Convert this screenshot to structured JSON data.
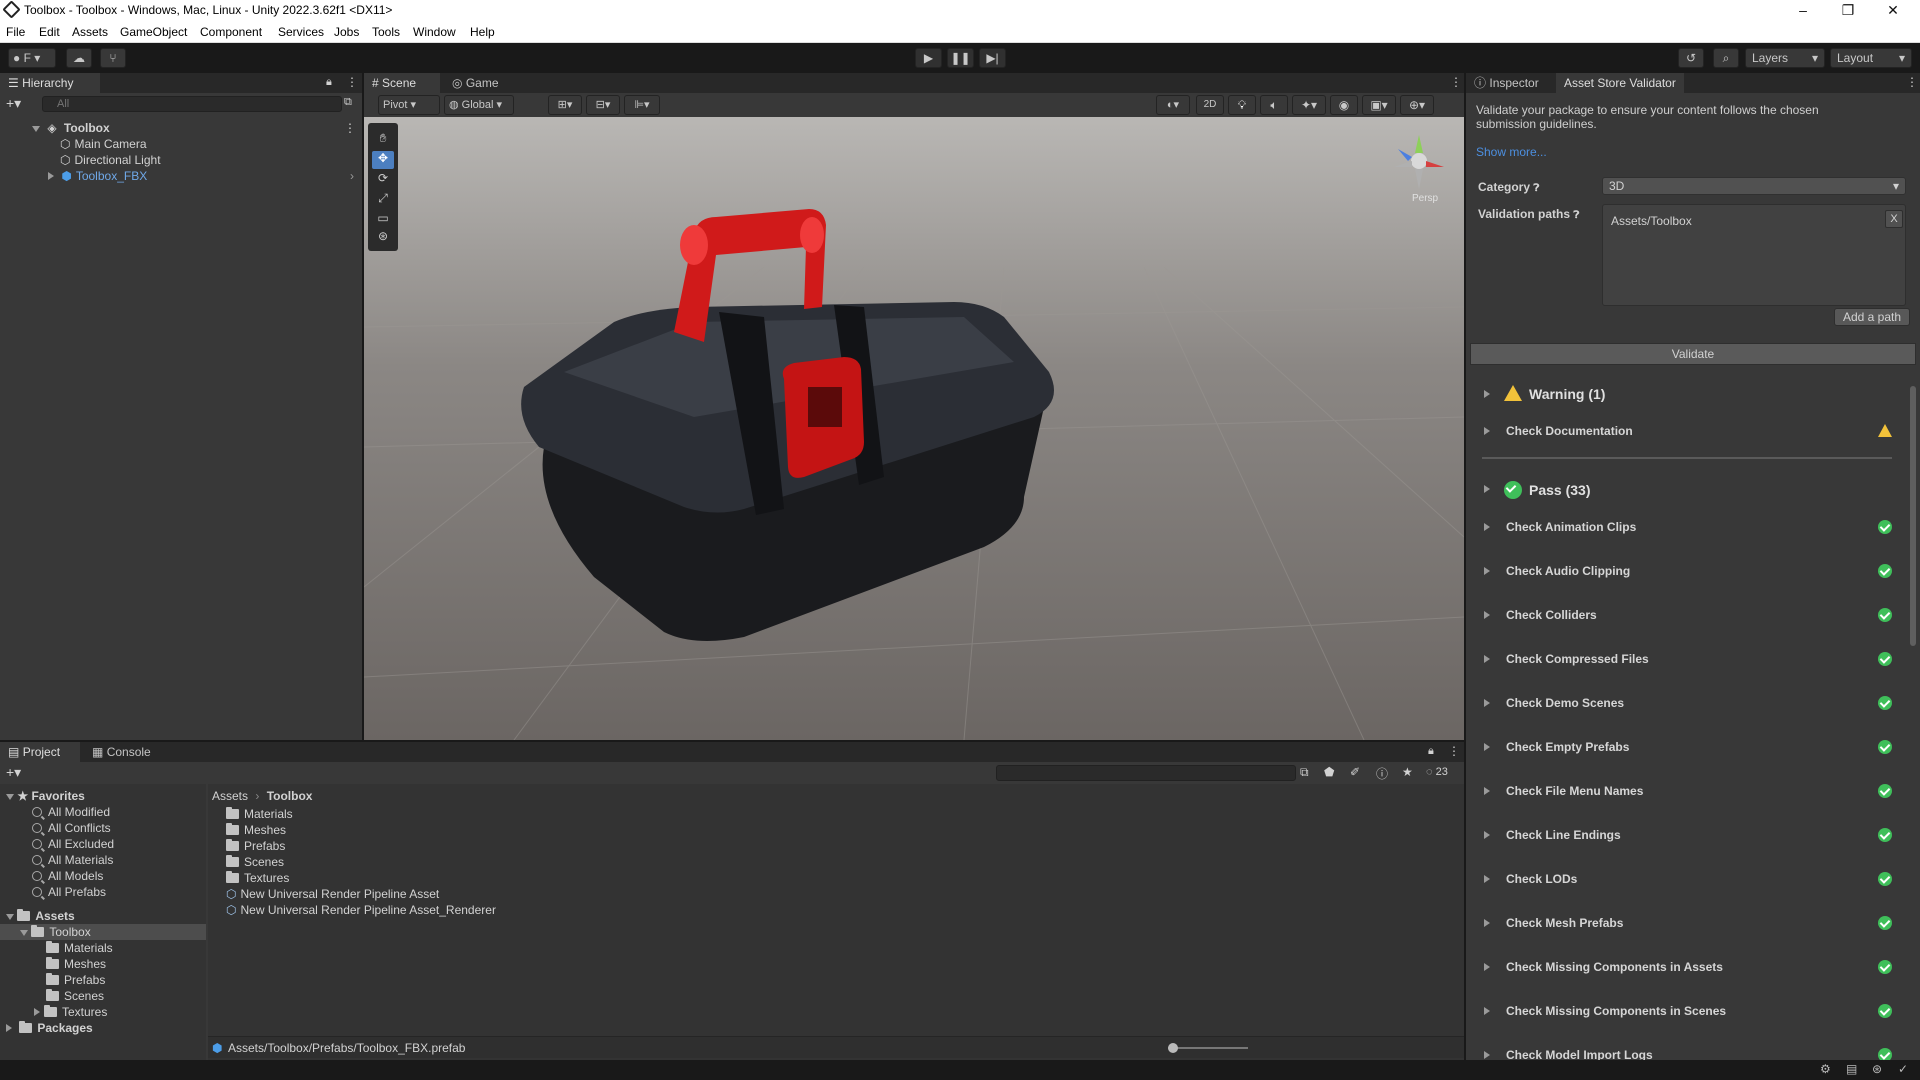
{
  "window": {
    "title": "Toolbox - Toolbox - Windows, Mac, Linux - Unity 2022.3.62f1 <DX11>"
  },
  "menu": [
    "File",
    "Edit",
    "Assets",
    "GameObject",
    "Component",
    "Services",
    "Jobs",
    "Tools",
    "Window",
    "Help"
  ],
  "toolbar": {
    "account_label": "F",
    "layers_label": "Layers",
    "layout_label": "Layout"
  },
  "hierarchy": {
    "tab": "Hierarchy",
    "search_placeholder": "All",
    "root": "Toolbox",
    "items": [
      "Main Camera",
      "Directional Light",
      "Toolbox_FBX"
    ]
  },
  "scene": {
    "tabs": [
      "Scene",
      "Game"
    ],
    "pivot": "Pivot",
    "global": "Global",
    "mode_2d": "2D",
    "persp": "Persp"
  },
  "inspector": {
    "tabs": [
      "Inspector",
      "Asset Store Validator"
    ],
    "description": "Validate your package to ensure your content follows the chosen submission guidelines.",
    "show_more": "Show more...",
    "category_label": "Category",
    "category_value": "3D",
    "paths_label": "Validation paths",
    "path_value": "Assets/Toolbox",
    "remove_path": "X",
    "add_path": "Add a path",
    "validate": "Validate",
    "warning_header": "Warning (1)",
    "warning_items": [
      "Check Documentation"
    ],
    "pass_header": "Pass (33)",
    "pass_items": [
      "Check Animation Clips",
      "Check Audio Clipping",
      "Check Colliders",
      "Check Compressed Files",
      "Check Demo Scenes",
      "Check Empty Prefabs",
      "Check File Menu Names",
      "Check Line Endings",
      "Check LODs",
      "Check Mesh Prefabs",
      "Check Missing Components in Assets",
      "Check Missing Components in Scenes",
      "Check Model Import Logs"
    ]
  },
  "project": {
    "tabs": [
      "Project",
      "Console"
    ],
    "favorites_label": "Favorites",
    "favorites": [
      "All Modified",
      "All Conflicts",
      "All Excluded",
      "All Materials",
      "All Models",
      "All Prefabs"
    ],
    "assets_label": "Assets",
    "toolbox_label": "Toolbox",
    "tree_children": [
      "Materials",
      "Meshes",
      "Prefabs",
      "Scenes",
      "Textures"
    ],
    "packages_label": "Packages",
    "breadcrumb": [
      "Assets",
      "Toolbox"
    ],
    "content_folders": [
      "Materials",
      "Meshes",
      "Prefabs",
      "Scenes",
      "Textures"
    ],
    "content_assets": [
      "New Universal Render Pipeline Asset",
      "New Universal Render Pipeline Asset_Renderer"
    ],
    "hidden_count": "23",
    "selected_path": "Assets/Toolbox/Prefabs/Toolbox_FBX.prefab"
  },
  "colors": {
    "accent_blue": "#4c7fc0",
    "pass_green": "#3fbf5a",
    "warn_yellow": "#f2c23a",
    "handle_red": "#d01a1a"
  }
}
